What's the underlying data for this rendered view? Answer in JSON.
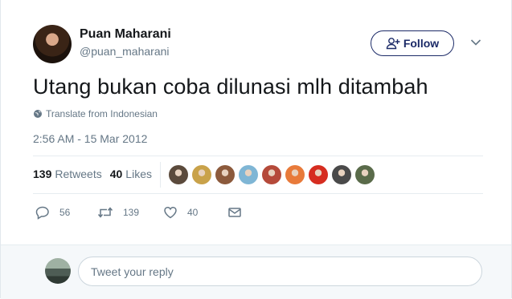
{
  "author": {
    "name": "Puan Maharani",
    "handle": "@puan_maharani"
  },
  "header": {
    "follow_label": "Follow"
  },
  "tweet": {
    "text": "Utang bukan coba dilunasi mlh ditambah",
    "translate_label": "Translate from Indonesian",
    "timestamp": "2:56 AM - 15 Mar 2012"
  },
  "stats": {
    "retweets_count": "139",
    "retweets_label": "Retweets",
    "likes_count": "40",
    "likes_label": "Likes"
  },
  "engagers": [
    "#5b4a3c",
    "#c9a24a",
    "#8c5a3c",
    "#7fb6d5",
    "#b54a3a",
    "#e87a3a",
    "#d62d20",
    "#4a4a4a",
    "#5a6b4a"
  ],
  "actions": {
    "replies": "56",
    "retweets": "139",
    "likes": "40"
  },
  "reply": {
    "placeholder": "Tweet your reply"
  },
  "colors": {
    "follow": "#1b2a67",
    "muted": "#657786",
    "text": "#14171a"
  }
}
